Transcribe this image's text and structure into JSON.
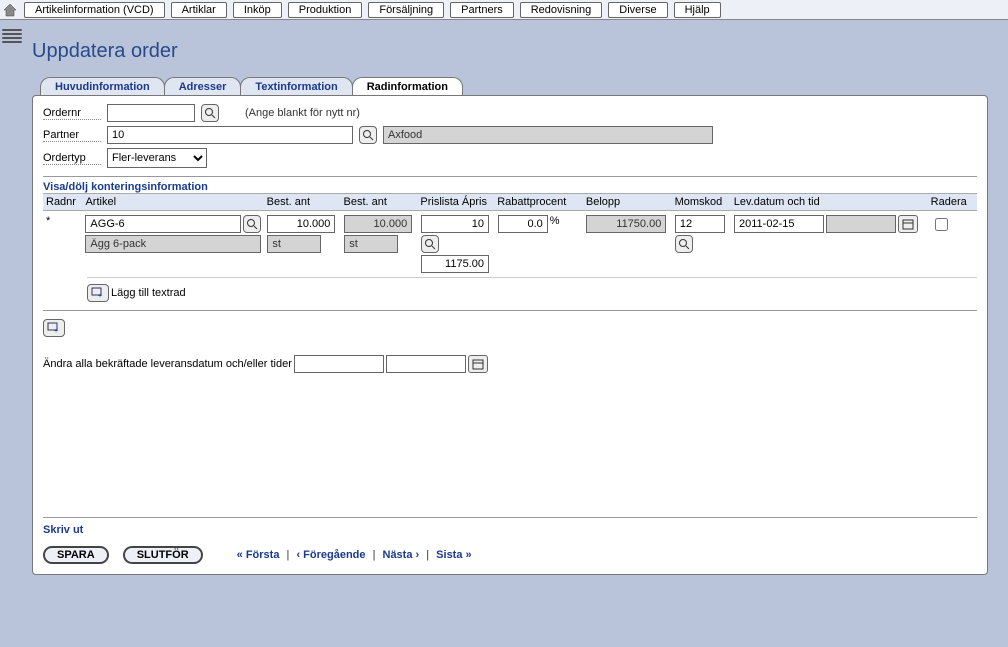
{
  "menu": {
    "items": [
      "Artikelinformation (VCD)",
      "Artiklar",
      "Inköp",
      "Produktion",
      "Försäljning",
      "Partners",
      "Redovisning",
      "Diverse",
      "Hjälp"
    ]
  },
  "title": "Uppdatera order",
  "tabs": [
    "Huvudinformation",
    "Adresser",
    "Textinformation",
    "Radinformation"
  ],
  "activeTab": 3,
  "header": {
    "ordernr_label": "Ordernr",
    "ordernr_value": "",
    "ordernr_hint": "(Ange blankt för nytt nr)",
    "partner_label": "Partner",
    "partner_value": "10",
    "partner_name": "Axfood",
    "ordertyp_label": "Ordertyp",
    "ordertyp_value": "Fler-leverans"
  },
  "section": {
    "toggle_label": "Visa/dölj konteringsinformation",
    "columns": {
      "radnr": "Radnr",
      "artikel": "Artikel",
      "best1": "Best. ant",
      "best2": "Best. ant",
      "apris": "Prislista Ápris",
      "rabatt": "Rabattprocent",
      "belopp": "Belopp",
      "momskod": "Momskod",
      "levdatum": "Lev.datum  och tid",
      "radera": "Radera"
    },
    "row": {
      "radnr": "*",
      "artikel_code": "AGG-6",
      "artikel_name": "Ägg 6-pack",
      "best1": "10.000",
      "best1_unit": "st",
      "best2": "10.000",
      "best2_unit": "st",
      "apris_top": "10",
      "apris_bottom": "1175.00",
      "rabatt": "0.0",
      "rabatt_unit": "%",
      "belopp": "11750.00",
      "momskod": "12",
      "levdatum": "2011-02-15",
      "levtid": ""
    },
    "add_text_label": "Lägg till textrad",
    "bulk_label": "Ändra alla bekräftade leveransdatum och/eller tider",
    "bulk_date": "",
    "bulk_time": ""
  },
  "footer": {
    "print": "Skriv ut",
    "save": "SPARA",
    "finish": "SLUTFÖR",
    "first": "« Första",
    "prev": "‹ Föregående",
    "next": "Nästa ›",
    "last": "Sista »"
  }
}
